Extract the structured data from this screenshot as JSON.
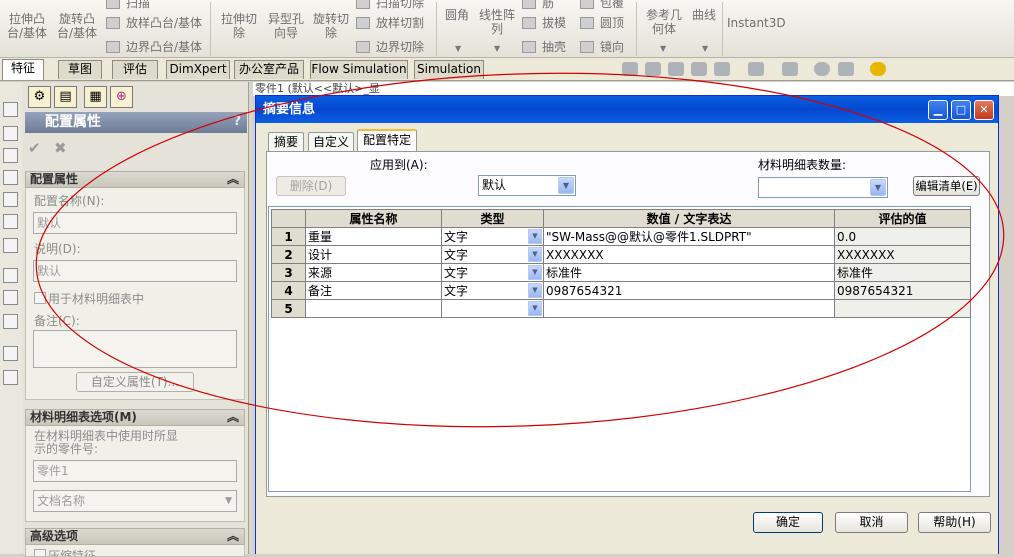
{
  "ribbon": {
    "groups": [
      {
        "label": "拉伸凸\n台/基体"
      },
      {
        "label": "旋转凸\n台/基体"
      },
      {
        "label": "拉伸切\n除"
      },
      {
        "label": "异型孔\n向导"
      },
      {
        "label": "旋转切\n除"
      },
      {
        "label": "圆角"
      },
      {
        "label": "线性阵\n列"
      },
      {
        "label": "参考几\n何体"
      },
      {
        "label": "曲线"
      },
      {
        "label": "Instant3D"
      }
    ],
    "small": {
      "sweep": "扫描",
      "loft_boss": "放样凸台/基体",
      "boundary_boss": "边界凸台/基体",
      "sweep_cut": "扫描切除",
      "loft_cut": "放样切割",
      "boundary_cut": "边界切除",
      "rib": "筋",
      "draft": "拔模",
      "shell": "抽壳",
      "wrap": "包覆",
      "dome": "圆顶",
      "mirror": "镜向"
    }
  },
  "cm_tabs": [
    "特征",
    "草图",
    "评估",
    "DimXpert",
    "办公室产品",
    "Flow Simulation",
    "Simulation"
  ],
  "property_manager": {
    "title": "配置属性",
    "help": "?",
    "config_group": {
      "title": "配置属性",
      "name_label": "配置名称(N):",
      "name_value": "默认",
      "desc_label": "说明(D):",
      "desc_value": "默认",
      "bom_checkbox": "用于材料明细表中",
      "comment_label": "备注(C):",
      "custom_props_button": "自定义属性(T)..."
    },
    "bom_group": {
      "title": "材料明细表选项(M)",
      "desc": "在材料明细表中使用时所显\n示的零件号:",
      "part_value": "零件1",
      "doc_name_option": "文档名称"
    },
    "advanced_group": {
      "title": "高级选项",
      "first_item": "压缩特征"
    }
  },
  "tree_bar": "零件1 (默认<<默认>_显",
  "dialog": {
    "title": "摘要信息",
    "tabs": [
      "摘要",
      "自定义",
      "配置特定"
    ],
    "active_tab": "配置特定",
    "apply_to_label": "应用到(A):",
    "apply_to_value": "默认",
    "bom_qty_label": "材料明细表数量:",
    "bom_qty_value": "",
    "delete_button": "删除(D)",
    "edit_list_button": "编辑清单(E)",
    "table": {
      "columns": [
        "",
        "属性名称",
        "类型",
        "数值 / 文字表达",
        "评估的值"
      ],
      "rows": [
        {
          "num": "1",
          "name": "重量",
          "type": "文字",
          "value": "\"SW-Mass@@默认@零件1.SLDPRT\"",
          "evaluated": "0.0"
        },
        {
          "num": "2",
          "name": "设计",
          "type": "文字",
          "value": "XXXXXXX",
          "evaluated": "XXXXXXX"
        },
        {
          "num": "3",
          "name": "来源",
          "type": "文字",
          "value": "标准件",
          "evaluated": "标准件"
        },
        {
          "num": "4",
          "name": "备注",
          "type": "文字",
          "value": "0987654321",
          "evaluated": "0987654321"
        },
        {
          "num": "5",
          "name": "",
          "type": "",
          "value": "",
          "evaluated": ""
        }
      ]
    },
    "ok_button": "确定",
    "cancel_button": "取消",
    "help_button": "帮助(H)"
  },
  "colors": {
    "title_bar": "#0a5ee0",
    "annotation_ellipse": "#d40000",
    "window_bg": "#ece9d8"
  }
}
